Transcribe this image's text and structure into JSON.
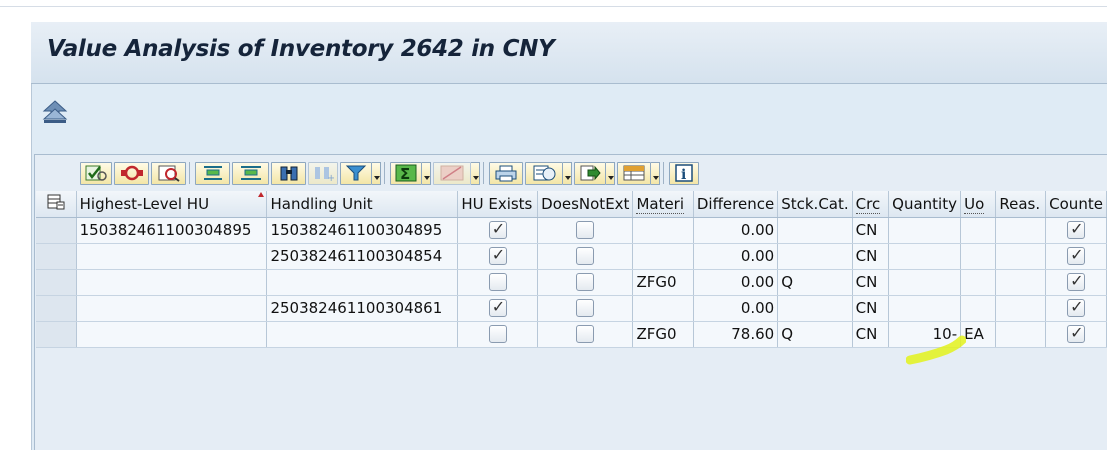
{
  "title": "Value Analysis of Inventory 2642 in CNY",
  "colors": {
    "title_bg": "#d5e2ee",
    "highlight": "#e3f21b",
    "button_bg": "#f3e6a6"
  },
  "toolbar": {
    "buttons": [
      "check-icon",
      "refresh-icon",
      "details-icon",
      "align-icon",
      "sort-icon",
      "find-icon",
      "find-next-icon",
      "filter-icon",
      "sum-icon",
      "subtotal-icon",
      "print-icon",
      "view-icon",
      "export-icon",
      "layout-icon",
      "info-icon"
    ]
  },
  "table": {
    "headers": {
      "highest_hu": "Highest-Level HU",
      "handling_unit": "Handling Unit",
      "hu_exists": "HU Exists",
      "does_not_exist": "DoesNotExt",
      "material": "Materi",
      "difference": "Difference",
      "stock_cat": "Stck.Cat.",
      "currency": "Crc",
      "quantity": "Quantity",
      "uom": "Uo",
      "reason": "Reas.",
      "counted": "Counte"
    },
    "rows": [
      {
        "highest_hu": "150382461100304895",
        "handling_unit": "150382461100304895",
        "hu_exists": true,
        "does_not_exist": false,
        "material": "",
        "difference": "0.00",
        "stock_cat": "",
        "currency": "CN",
        "quantity": "",
        "uom": "",
        "reason": "",
        "counted": true
      },
      {
        "highest_hu": "",
        "handling_unit": "250382461100304854",
        "hu_exists": true,
        "does_not_exist": false,
        "material": "",
        "difference": "0.00",
        "stock_cat": "",
        "currency": "CN",
        "quantity": "",
        "uom": "",
        "reason": "",
        "counted": true
      },
      {
        "highest_hu": "",
        "handling_unit": "",
        "hu_exists": false,
        "does_not_exist": false,
        "material": "ZFG0",
        "difference": "0.00",
        "stock_cat": "Q",
        "currency": "CN",
        "quantity": "",
        "uom": "",
        "reason": "",
        "counted": true
      },
      {
        "highest_hu": "",
        "handling_unit": "250382461100304861",
        "hu_exists": true,
        "does_not_exist": false,
        "material": "",
        "difference": "0.00",
        "stock_cat": "",
        "currency": "CN",
        "quantity": "",
        "uom": "",
        "reason": "",
        "counted": true
      },
      {
        "highest_hu": "",
        "handling_unit": "",
        "hu_exists": false,
        "does_not_exist": false,
        "material": "ZFG0",
        "difference": "78.60",
        "stock_cat": "Q",
        "currency": "CN",
        "quantity": "10-",
        "uom": "EA",
        "reason": "",
        "counted": true
      }
    ]
  }
}
